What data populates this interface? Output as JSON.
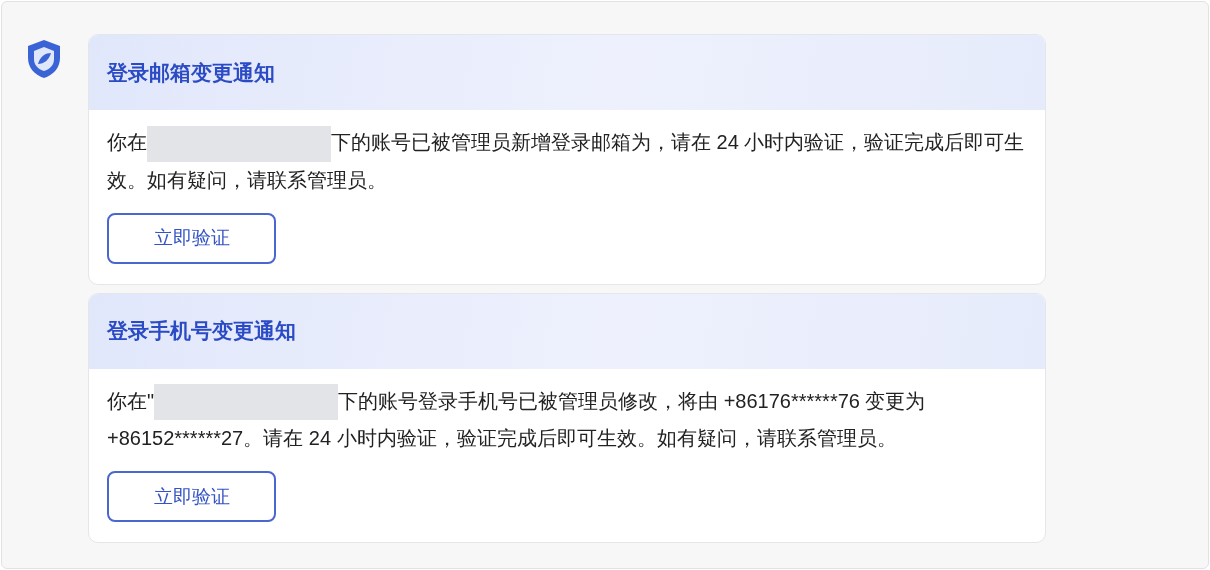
{
  "notices": [
    {
      "title": "登录邮箱变更通知",
      "text_before": "你在",
      "redacted": true,
      "text_after": "下的账号已被管理员新增登录邮箱为，请在 24 小时内验证，验证完成后即可生效。如有疑问，请联系管理员。",
      "button": "立即验证"
    },
    {
      "title": "登录手机号变更通知",
      "text_before": "你在\"",
      "redacted": true,
      "text_after": "下的账号登录手机号已被管理员修改，将由 +86176******76 变更为 +86152******27。请在 24 小时内验证，验证完成后即可生效。如有疑问，请联系管理员。",
      "button": "立即验证"
    }
  ]
}
